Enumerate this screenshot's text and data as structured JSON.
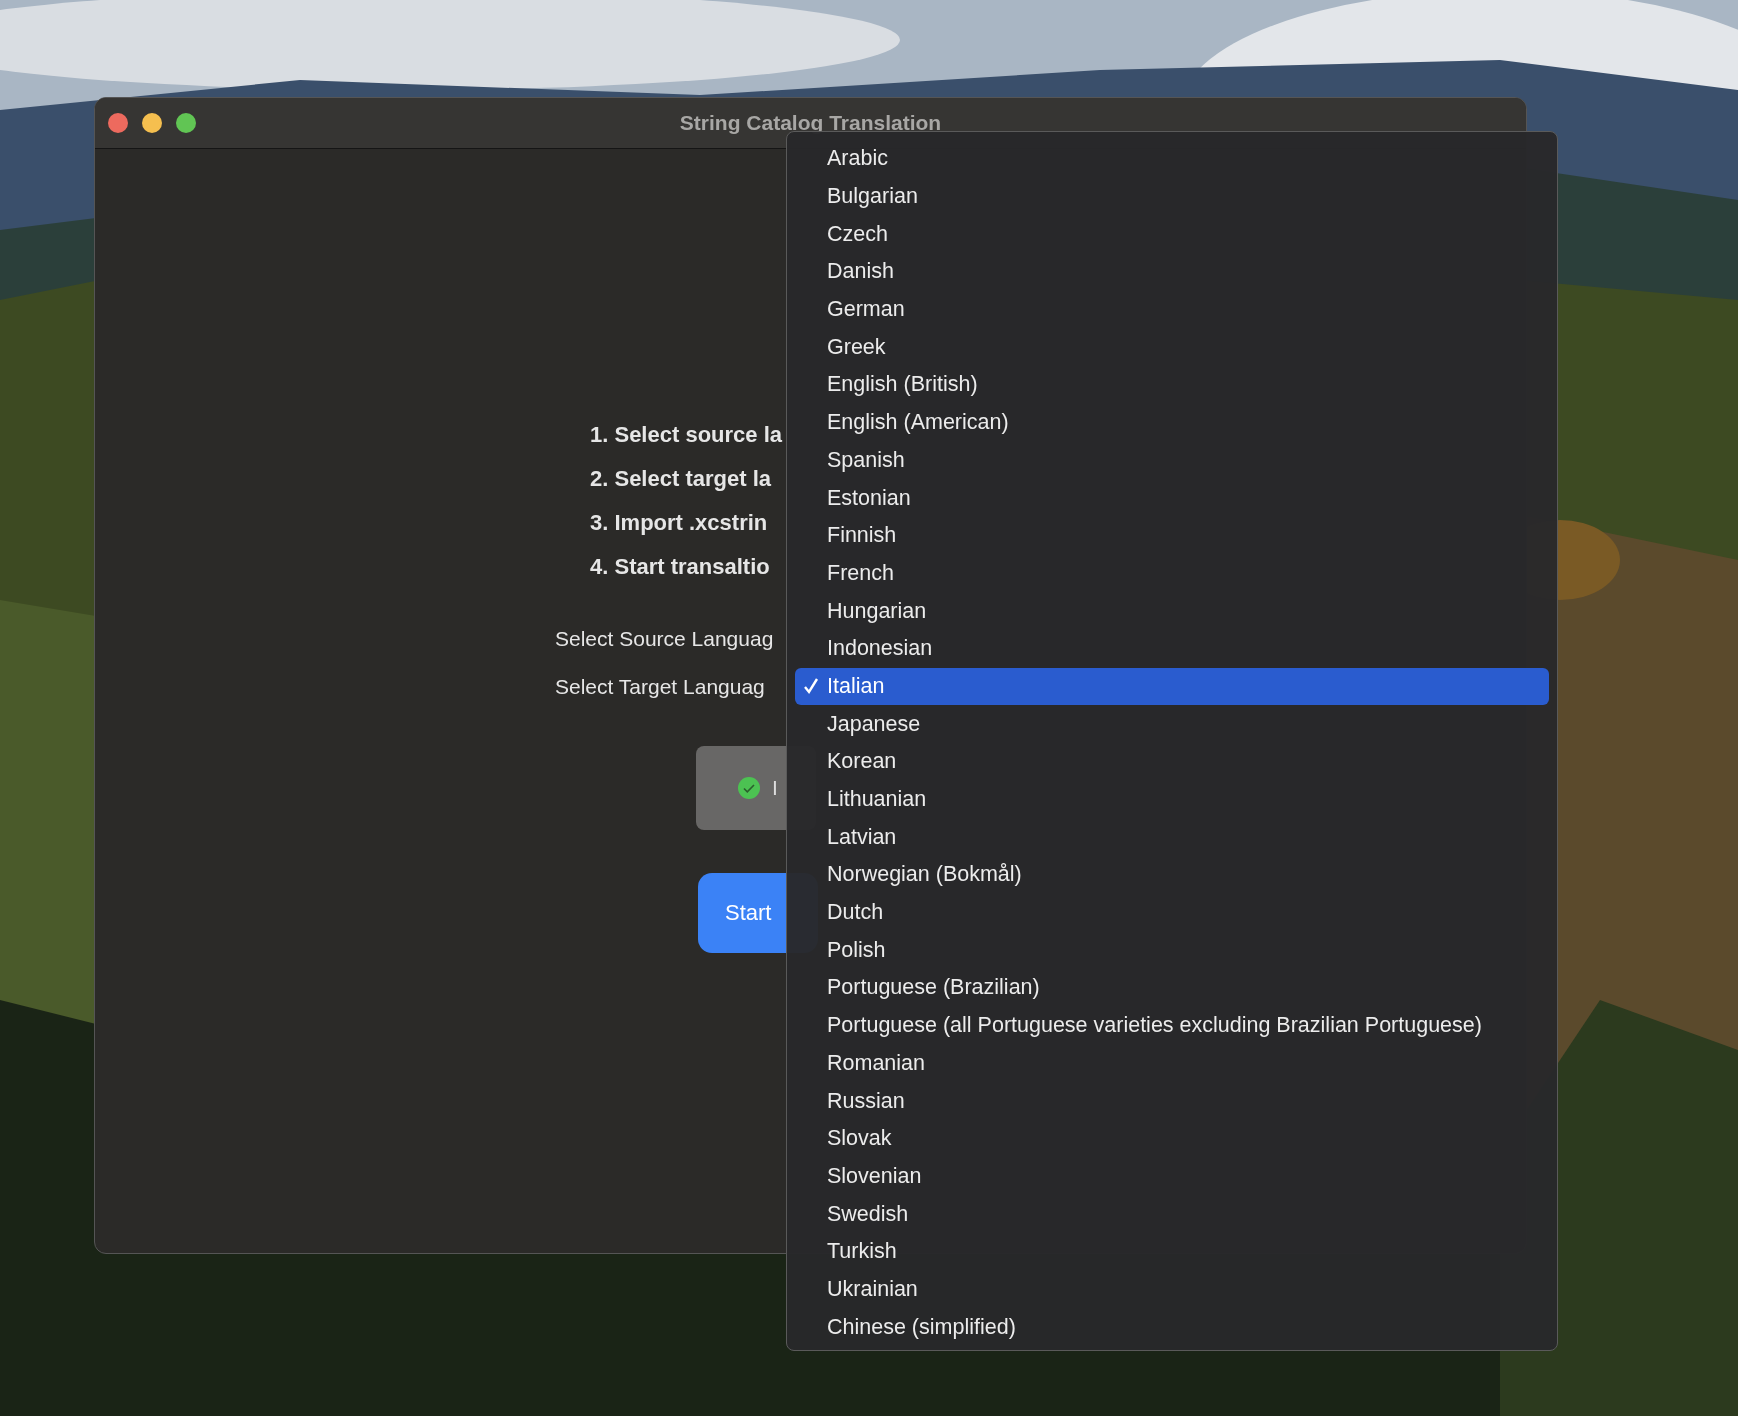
{
  "window": {
    "title": "String Catalog Translation"
  },
  "instructions": [
    "1. Select source la",
    "2. Select target la",
    "3. Import .xcstrin",
    "4. Start transaltio"
  ],
  "language_rows": [
    {
      "label": "Select Source Languag"
    },
    {
      "label": "Select Target Languag"
    }
  ],
  "import_button": {
    "label": "I",
    "completed": true
  },
  "start_button": {
    "label": "Start"
  },
  "language_menu": {
    "items": [
      {
        "label": "Arabic",
        "selected": false
      },
      {
        "label": "Bulgarian",
        "selected": false
      },
      {
        "label": "Czech",
        "selected": false
      },
      {
        "label": "Danish",
        "selected": false
      },
      {
        "label": "German",
        "selected": false
      },
      {
        "label": "Greek",
        "selected": false
      },
      {
        "label": "English (British)",
        "selected": false
      },
      {
        "label": "English (American)",
        "selected": false
      },
      {
        "label": "Spanish",
        "selected": false
      },
      {
        "label": "Estonian",
        "selected": false
      },
      {
        "label": "Finnish",
        "selected": false
      },
      {
        "label": "French",
        "selected": false
      },
      {
        "label": "Hungarian",
        "selected": false
      },
      {
        "label": "Indonesian",
        "selected": false
      },
      {
        "label": "Italian",
        "selected": true
      },
      {
        "label": "Japanese",
        "selected": false
      },
      {
        "label": "Korean",
        "selected": false
      },
      {
        "label": "Lithuanian",
        "selected": false
      },
      {
        "label": "Latvian",
        "selected": false
      },
      {
        "label": "Norwegian (Bokmål)",
        "selected": false
      },
      {
        "label": "Dutch",
        "selected": false
      },
      {
        "label": "Polish",
        "selected": false
      },
      {
        "label": "Portuguese (Brazilian)",
        "selected": false
      },
      {
        "label": "Portuguese (all Portuguese varieties excluding Brazilian Portuguese)",
        "selected": false
      },
      {
        "label": "Romanian",
        "selected": false
      },
      {
        "label": "Russian",
        "selected": false
      },
      {
        "label": "Slovak",
        "selected": false
      },
      {
        "label": "Slovenian",
        "selected": false
      },
      {
        "label": "Swedish",
        "selected": false
      },
      {
        "label": "Turkish",
        "selected": false
      },
      {
        "label": "Ukrainian",
        "selected": false
      },
      {
        "label": "Chinese (simplified)",
        "selected": false
      }
    ]
  }
}
